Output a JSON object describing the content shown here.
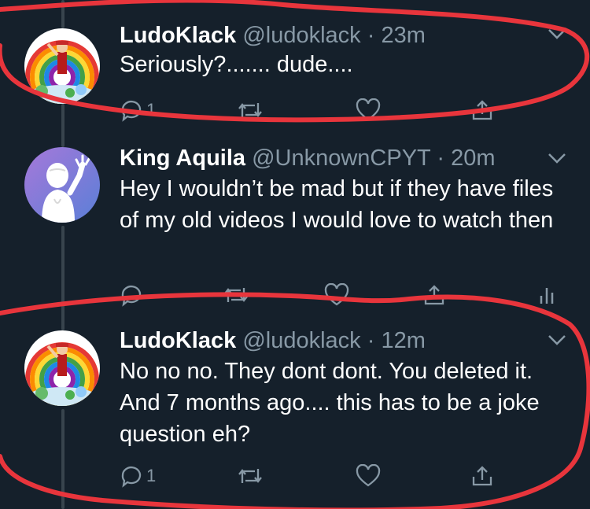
{
  "colors": {
    "background": "#15202b",
    "text": "#ffffff",
    "secondary": "#8899a6",
    "thread_line": "#38444d",
    "annotation": "#e8353c"
  },
  "tweets": [
    {
      "display_name": "LudoKlack",
      "handle": "@ludoklack",
      "separator": "·",
      "time": "23m",
      "text": "Seriously?....... dude....",
      "reply_count": "1",
      "avatar_icon": "rainbow-avatar"
    },
    {
      "display_name": "King Aquila",
      "handle": "@UnknownCPYT",
      "separator": "·",
      "time": "20m",
      "text": "Hey I wouldn’t be mad but if they have files of my old videos I would love to watch then",
      "reply_count": "",
      "avatar_icon": "waving-character-avatar"
    },
    {
      "display_name": "LudoKlack",
      "handle": "@ludoklack",
      "separator": "·",
      "time": "12m",
      "text": "No no no. They dont dont. You deleted it. And 7 months ago.... this has to be a joke question eh?",
      "reply_count": "1",
      "avatar_icon": "rainbow-avatar"
    }
  ],
  "icons": {
    "reply": "reply-icon",
    "retweet": "retweet-icon",
    "like": "heart-icon",
    "share": "share-icon",
    "analytics": "analytics-icon",
    "more": "chevron-down-icon"
  }
}
